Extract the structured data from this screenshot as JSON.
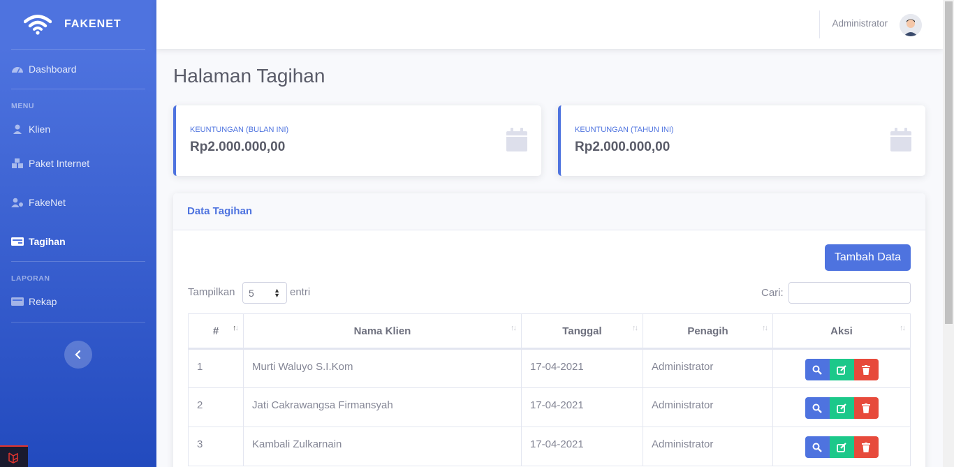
{
  "brand": {
    "name": "FAKENET"
  },
  "sidebar": {
    "dashboard": "Dashboard",
    "heading_menu": "MENU",
    "items": [
      {
        "label": "Klien",
        "icon": "user-icon"
      },
      {
        "label": "Paket Internet",
        "icon": "boxes-icon"
      },
      {
        "label": "FakeNet",
        "icon": "user-gear-icon"
      },
      {
        "label": "Tagihan",
        "icon": "money-check-icon",
        "active": true
      }
    ],
    "heading_report": "LAPORAN",
    "report_items": [
      {
        "label": "Rekap",
        "icon": "money-check-icon"
      }
    ]
  },
  "topbar": {
    "user": "Administrator"
  },
  "page": {
    "title": "Halaman Tagihan"
  },
  "stats": [
    {
      "label": "KEUNTUNGAN (BULAN INI)",
      "value": "Rp2.000.000,00"
    },
    {
      "label": "KEUNTUNGAN (TAHUN INI)",
      "value": "Rp2.000.000,00"
    }
  ],
  "table_card": {
    "title": "Data Tagihan",
    "add_button": "Tambah Data",
    "length_label": "Tampilkan",
    "length_value": "5",
    "length_after": "entri",
    "search_label": "Cari:",
    "columns": [
      "#",
      "Nama Klien",
      "Tanggal",
      "Penagih",
      "Aksi"
    ],
    "rows": [
      {
        "no": "1",
        "nama": "Murti Waluyo S.I.Kom",
        "tanggal": "17-04-2021",
        "penagih": "Administrator"
      },
      {
        "no": "2",
        "nama": "Jati Cakrawangsa Firmansyah",
        "tanggal": "17-04-2021",
        "penagih": "Administrator"
      },
      {
        "no": "3",
        "nama": "Kambali Zulkarnain",
        "tanggal": "17-04-2021",
        "penagih": "Administrator"
      }
    ]
  },
  "colors": {
    "primary": "#4e73df",
    "success": "#1cc88a",
    "danger": "#e74a3b"
  }
}
